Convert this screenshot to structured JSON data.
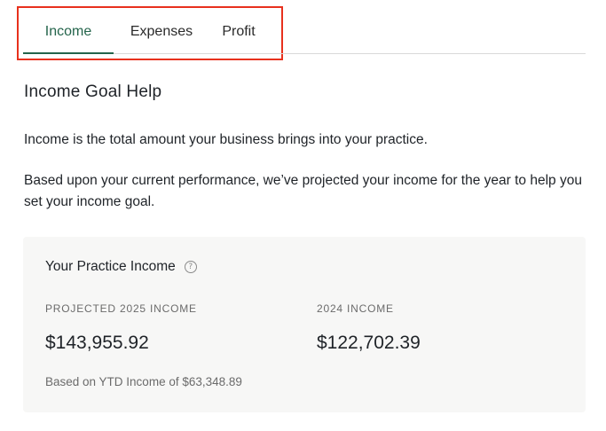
{
  "tabs": [
    {
      "label": "Income",
      "active": true
    },
    {
      "label": "Expenses",
      "active": false
    },
    {
      "label": "Profit",
      "active": false
    }
  ],
  "help": {
    "title": "Income Goal Help",
    "paragraph1": "Income is the total amount your business brings into your practice.",
    "paragraph2": "Based upon your current performance, we’ve projected your income for the year to help you set your income goal."
  },
  "card": {
    "title": "Your Practice Income",
    "help_icon": "question-circle-icon",
    "projected_label": "PROJECTED 2025 INCOME",
    "projected_value": "$143,955.92",
    "prior_label": "2024 INCOME",
    "prior_value": "$122,702.39",
    "footnote": "Based on YTD Income of $63,348.89"
  },
  "colors": {
    "accent": "#24644b",
    "highlight_border": "#e8311d",
    "card_background": "#f7f7f6"
  }
}
